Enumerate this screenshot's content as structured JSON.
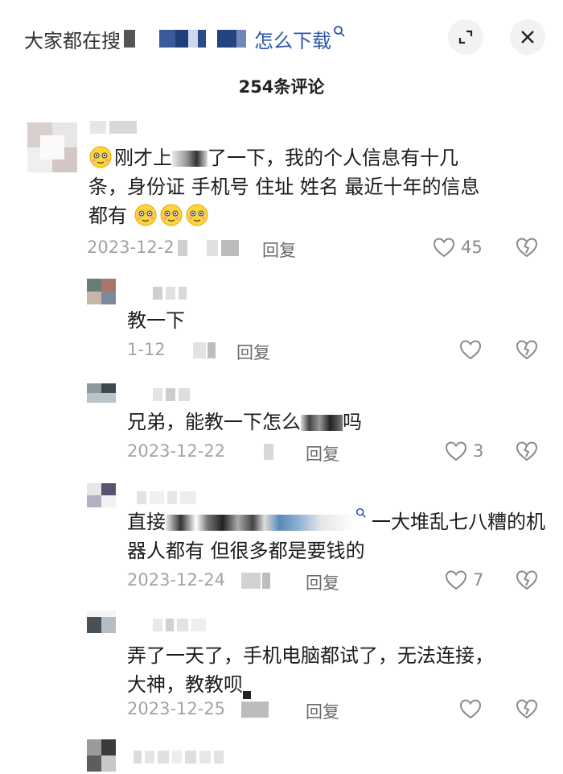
{
  "header": {
    "search_prefix": "大家都在搜",
    "search_link": "怎么下载",
    "icons": {
      "search": "search-icon",
      "collapse": "fullscreen-icon",
      "close": "close-icon"
    }
  },
  "comment_count": "254条评论",
  "comments": [
    {
      "line1": "刚才上",
      "line1b": "了一下，我的个人信息有十几",
      "line2": "条，身份证 手机号 住址 姓名 最近十年的信息",
      "line3": "都有",
      "date": "2023-12-2",
      "reply_label": "回复",
      "likes": "45"
    },
    {
      "text": "教一下",
      "date": "1-12",
      "reply_label": "回复",
      "likes": ""
    },
    {
      "text": "兄弟，能教一下怎么",
      "text_end": "吗",
      "date": "2023-12-22",
      "reply_label": "回复",
      "likes": "3"
    },
    {
      "line1": "直接",
      "line1b": "一大堆乱七八糟的机",
      "line2": "器人都有 但很多都是要钱的",
      "date": "2023-12-24",
      "reply_label": "回复",
      "likes": "7"
    },
    {
      "line1": "弄了一天了，手机电脑都试了，无法连接，",
      "line2": "大神，教教呗",
      "date": "2023-12-25",
      "reply_label": "回复",
      "likes": ""
    }
  ],
  "colors": {
    "link": "#2d57a8",
    "meta": "#a3a3a3",
    "icon": "#8a8a8a"
  }
}
